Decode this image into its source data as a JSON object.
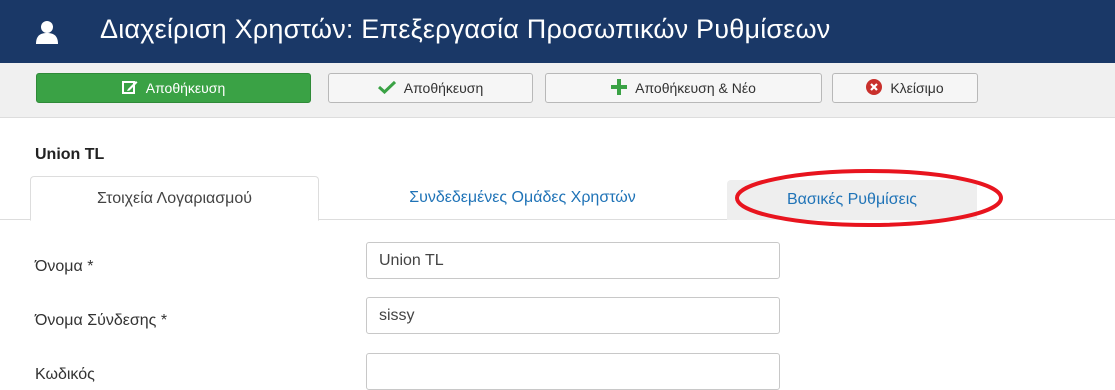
{
  "title_bar": {
    "title": "Διαχείριση Χρηστών: Επεξεργασία Προσωπικών Ρυθμίσεων",
    "icon": "user-icon",
    "background": "#1a3867"
  },
  "toolbar": {
    "save_primary_label": "Αποθήκευση",
    "save_secondary_label": "Αποθήκευση",
    "save_new_label": "Αποθήκευση & Νέο",
    "close_label": "Κλείσιμο",
    "colors": {
      "primary": "#3aa245",
      "plus": "#3aa245",
      "close": "#c9302c"
    }
  },
  "record": {
    "name": "Union TL"
  },
  "tabs": [
    {
      "label": "Στοιχεία Λογαριασμού",
      "active": true
    },
    {
      "label": "Συνδεδεμένες Ομάδες Χρηστών",
      "active": false
    },
    {
      "label": "Βασικές Ρυθμίσεις",
      "active": false,
      "highlighted": true
    }
  ],
  "form": {
    "name": {
      "label": "Όνομα *",
      "value": "Union TL"
    },
    "username": {
      "label": "Όνομα Σύνδεσης *",
      "value": "sissy"
    },
    "password": {
      "label": "Κωδικός",
      "value": ""
    }
  },
  "annotation": {
    "shape": "ellipse",
    "color": "#e8141e"
  }
}
